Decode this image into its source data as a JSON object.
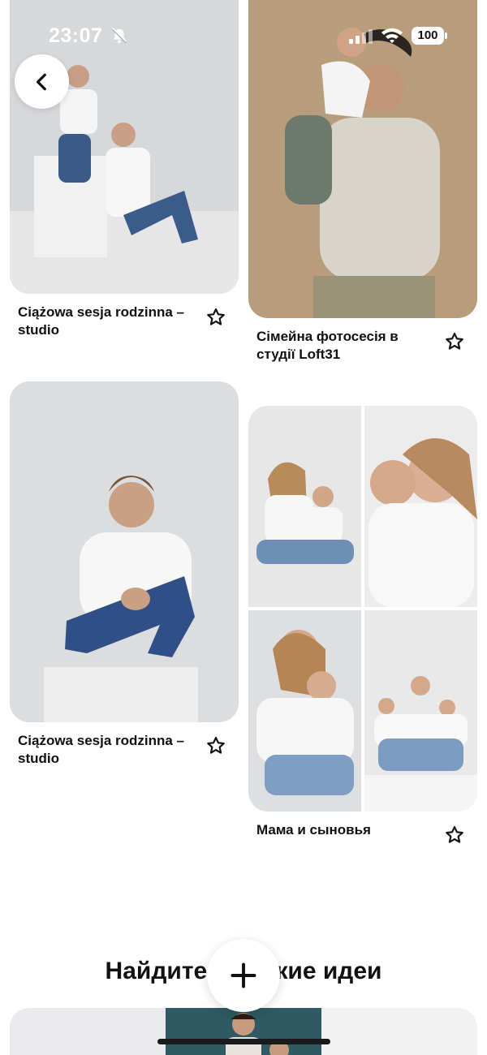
{
  "status_bar": {
    "time": "23:07",
    "battery": "100",
    "icons": [
      "bell-muted-icon",
      "signal-icon",
      "wifi-icon",
      "battery-icon"
    ]
  },
  "back_button": {
    "icon": "chevron-left-icon"
  },
  "pins": [
    {
      "title": "Ciążowa sesja rodzinna – studio",
      "icon": "star-icon"
    },
    {
      "title": "Сімейна фотосесія в студії Loft31",
      "icon": "star-icon"
    },
    {
      "title": "Ciążowa sesja rodzinna – studio",
      "icon": "star-icon"
    },
    {
      "title": "Мама и сыновья",
      "icon": "star-icon"
    }
  ],
  "section": {
    "heading": "Найдите похожие идеи"
  },
  "add_button": {
    "icon": "plus-icon"
  },
  "colors": {
    "background": "#ffffff",
    "text": "#111111",
    "photo_backdrop_gray": "#d9dadc",
    "photo_backdrop_beige": "#b79d7c",
    "bottom_photo_teal": "#2f5a63"
  }
}
